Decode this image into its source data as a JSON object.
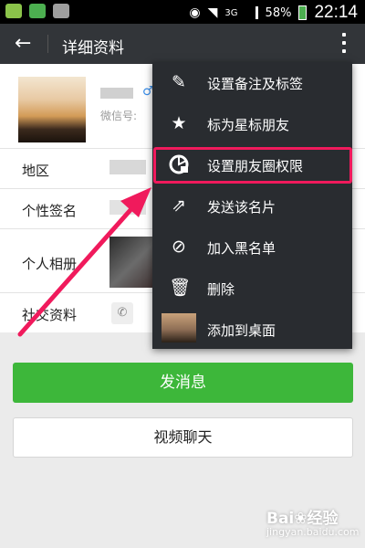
{
  "statusbar": {
    "net": "3G",
    "battery": "58%",
    "time": "22:14"
  },
  "toolbar": {
    "title": "详细资料"
  },
  "profile": {
    "wechat_id_label": "微信号:"
  },
  "info": {
    "region_label": "地区",
    "signature_label": "个性签名",
    "album_label": "个人相册",
    "social_label": "社交资料"
  },
  "menu": {
    "items": [
      {
        "label": "设置备注及标签",
        "icon": "pencil-icon"
      },
      {
        "label": "标为星标朋友",
        "icon": "star-icon"
      },
      {
        "label": "设置朋友圈权限",
        "icon": "moments-lock-icon"
      },
      {
        "label": "发送该名片",
        "icon": "share-icon"
      },
      {
        "label": "加入黑名单",
        "icon": "block-icon"
      },
      {
        "label": "删除",
        "icon": "trash-icon"
      },
      {
        "label": "添加到桌面",
        "icon": "thumbnail"
      }
    ]
  },
  "buttons": {
    "send_message": "发消息",
    "video_chat": "视频聊天"
  },
  "watermark": {
    "brand": "Bai❀经验",
    "url": "jingyan.baidu.com"
  }
}
